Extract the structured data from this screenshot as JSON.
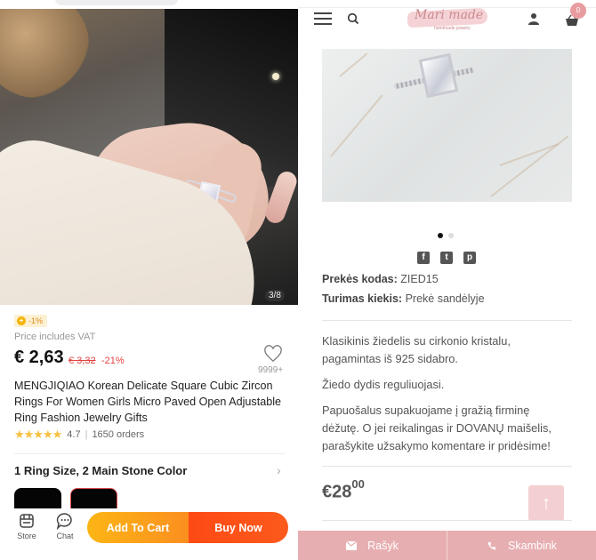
{
  "left": {
    "image_counter": "3/8",
    "promo_badge": "-1%",
    "promo_coin": "+",
    "vat_note": "Price includes VAT",
    "price": "€ 2,63",
    "old_price": "€ 3,32",
    "discount": "-21%",
    "wishlist_count": "9999+",
    "title": "MENGJIQIAO Korean Delicate Square Cubic Zircon Rings For Women Girls Micro Paved Open Adjustable Ring Fashion Jewelry Gifts",
    "rating": {
      "stars": "★★★★★",
      "value": "4.7",
      "separator": "|",
      "orders": "1650 orders"
    },
    "variant_summary": "1 Ring Size, 2 Main Stone Color",
    "variant_chevron": "›",
    "bottom_bar": {
      "store_label": "Store",
      "chat_label": "Chat",
      "add_to_cart": "Add To Cart",
      "buy_now": "Buy Now"
    },
    "colors": {
      "accent_orange": "#fb8f20",
      "accent_red": "#fe4a14",
      "discount_red": "#e24141",
      "star_yellow": "#f7c03f"
    }
  },
  "right": {
    "header": {
      "brand": "Mari made",
      "brand_tagline": "handmade jewelry",
      "cart_count": "0"
    },
    "carousel": {
      "total_slides": 2,
      "active_slide": 1
    },
    "social": {
      "facebook": "f",
      "twitter": "t",
      "pinterest": "p"
    },
    "product_code_label": "Prekės kodas:",
    "product_code": "ZIED15",
    "stock_label": "Turimas kiekis:",
    "stock_value": "Prekė sandėlyje",
    "description": [
      "Klasikinis žiedelis su cirkonio kristalu, pagamintas iš 925 sidabro.",
      "Žiedo dydis reguliuojasi.",
      "Papuošalus supakuojame į gražią firminę dėžutę. O jei reikalingas ir DOVANŲ maišelis, parašykite užsakymo komentare ir pridėsime!"
    ],
    "price_main": "€28",
    "price_cents": "00",
    "scroll_top": "↑",
    "contact": {
      "write": "Rašyk",
      "call": "Skambink"
    },
    "colors": {
      "brand_pink": "#e7aeb1",
      "badge_pink": "#e89ca0"
    }
  }
}
